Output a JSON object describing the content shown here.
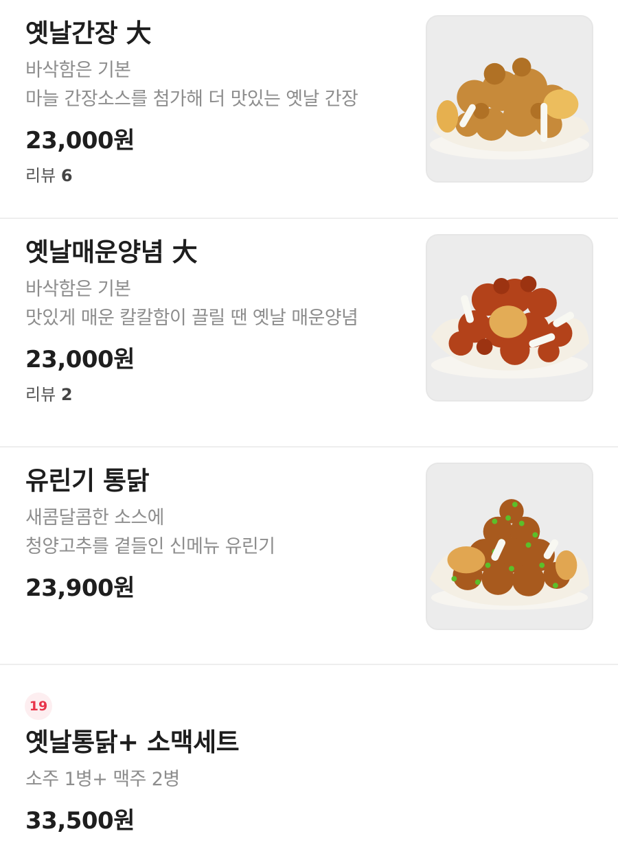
{
  "menu": {
    "items": [
      {
        "name": "옛날간장 大",
        "desc_line1": "바삭함은 기본",
        "desc_line2": "마늘 간장소스를 첨가해 더 맛있는 옛날 간장",
        "price": "23,000원",
        "review_label": "리뷰",
        "review_count": "6",
        "image": "soy-chicken-photo"
      },
      {
        "name": "옛날매운양념 大",
        "desc_line1": "바삭함은 기본",
        "desc_line2": "맛있게 매운 칼칼함이 끌릴 땐 옛날 매운양념",
        "price": "23,000원",
        "review_label": "리뷰",
        "review_count": "2",
        "image": "spicy-chicken-photo"
      },
      {
        "name": "유린기 통닭",
        "desc_line1": "새콤달콤한 소스에",
        "desc_line2": "청양고추를 곁들인 신메뉴 유린기",
        "price": "23,900원",
        "image": "yuringi-chicken-photo"
      },
      {
        "badge": "19",
        "name": "옛날통닭+ 소맥세트",
        "desc_line1": "소주 1병+ 맥주 2병",
        "price": "33,500원"
      }
    ]
  },
  "colors": {
    "badge_text": "#e8344a",
    "badge_bg": "#fdeef0",
    "desc_text": "#8d8d8d",
    "divider": "#eeeeee"
  }
}
